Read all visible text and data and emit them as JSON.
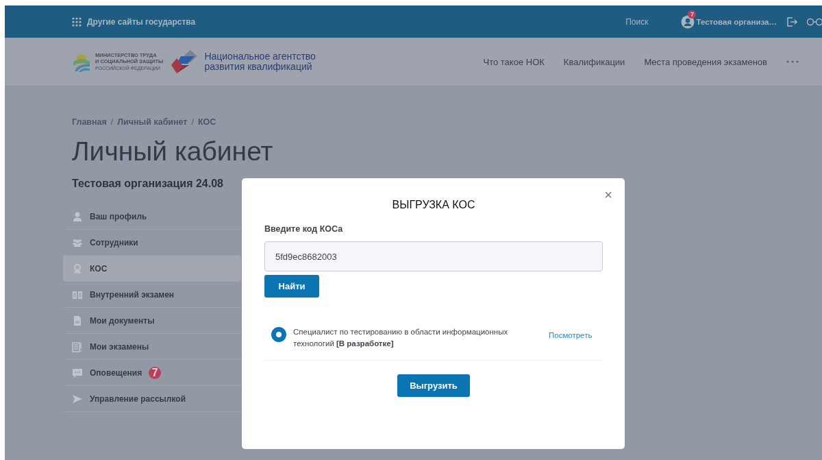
{
  "top_bar": {
    "other_sites": "Другие сайты государства",
    "search": "Поиск",
    "user": {
      "name": "Тестовая организа…",
      "badge": "7"
    }
  },
  "header": {
    "ministry": [
      "МИНИСТЕРСТВО ТРУДА",
      "И СОЦИАЛЬНОЙ ЗАЩИТЫ",
      "РОССИЙСКОЙ ФЕДЕРАЦИИ"
    ],
    "agency": [
      "Национальное агентство",
      "развития квалификаций"
    ],
    "nav": [
      "Что такое НОК",
      "Квалификации",
      "Места проведения экзаменов"
    ]
  },
  "breadcrumbs": [
    "Главная",
    "/",
    "Личный кабинет",
    "/",
    "КОС"
  ],
  "page_title": "Личный кабинет",
  "organization": "Тестовая организация 24.08",
  "sidebar": {
    "items": [
      {
        "kind": "profile",
        "label": "Ваш профиль",
        "selected": false
      },
      {
        "kind": "staff",
        "label": "Сотрудники",
        "selected": false
      },
      {
        "kind": "award",
        "label": "КОС",
        "selected": true
      },
      {
        "kind": "book",
        "label": "Внутренний экзамен",
        "selected": false
      },
      {
        "kind": "doc",
        "label": "Мои документы",
        "selected": false
      },
      {
        "kind": "exam",
        "label": "Мои экзамены",
        "selected": false
      },
      {
        "kind": "chat",
        "label": "Оповещения",
        "selected": false,
        "badge": "7"
      },
      {
        "kind": "send",
        "label": "Управление рассылкой",
        "selected": false
      }
    ]
  },
  "modal": {
    "close": "×",
    "title": "ВЫГРУЗКА КОС",
    "field_label": "Введите код КОСа",
    "field_value": "5fd9ec8682003",
    "find_button": "Найти",
    "results": [
      {
        "text": "Специалист по тестированию в области информационных технологий **[В разработке]**",
        "selected": true,
        "link": "Посмотреть"
      }
    ],
    "export_button": "Выгрузить"
  }
}
